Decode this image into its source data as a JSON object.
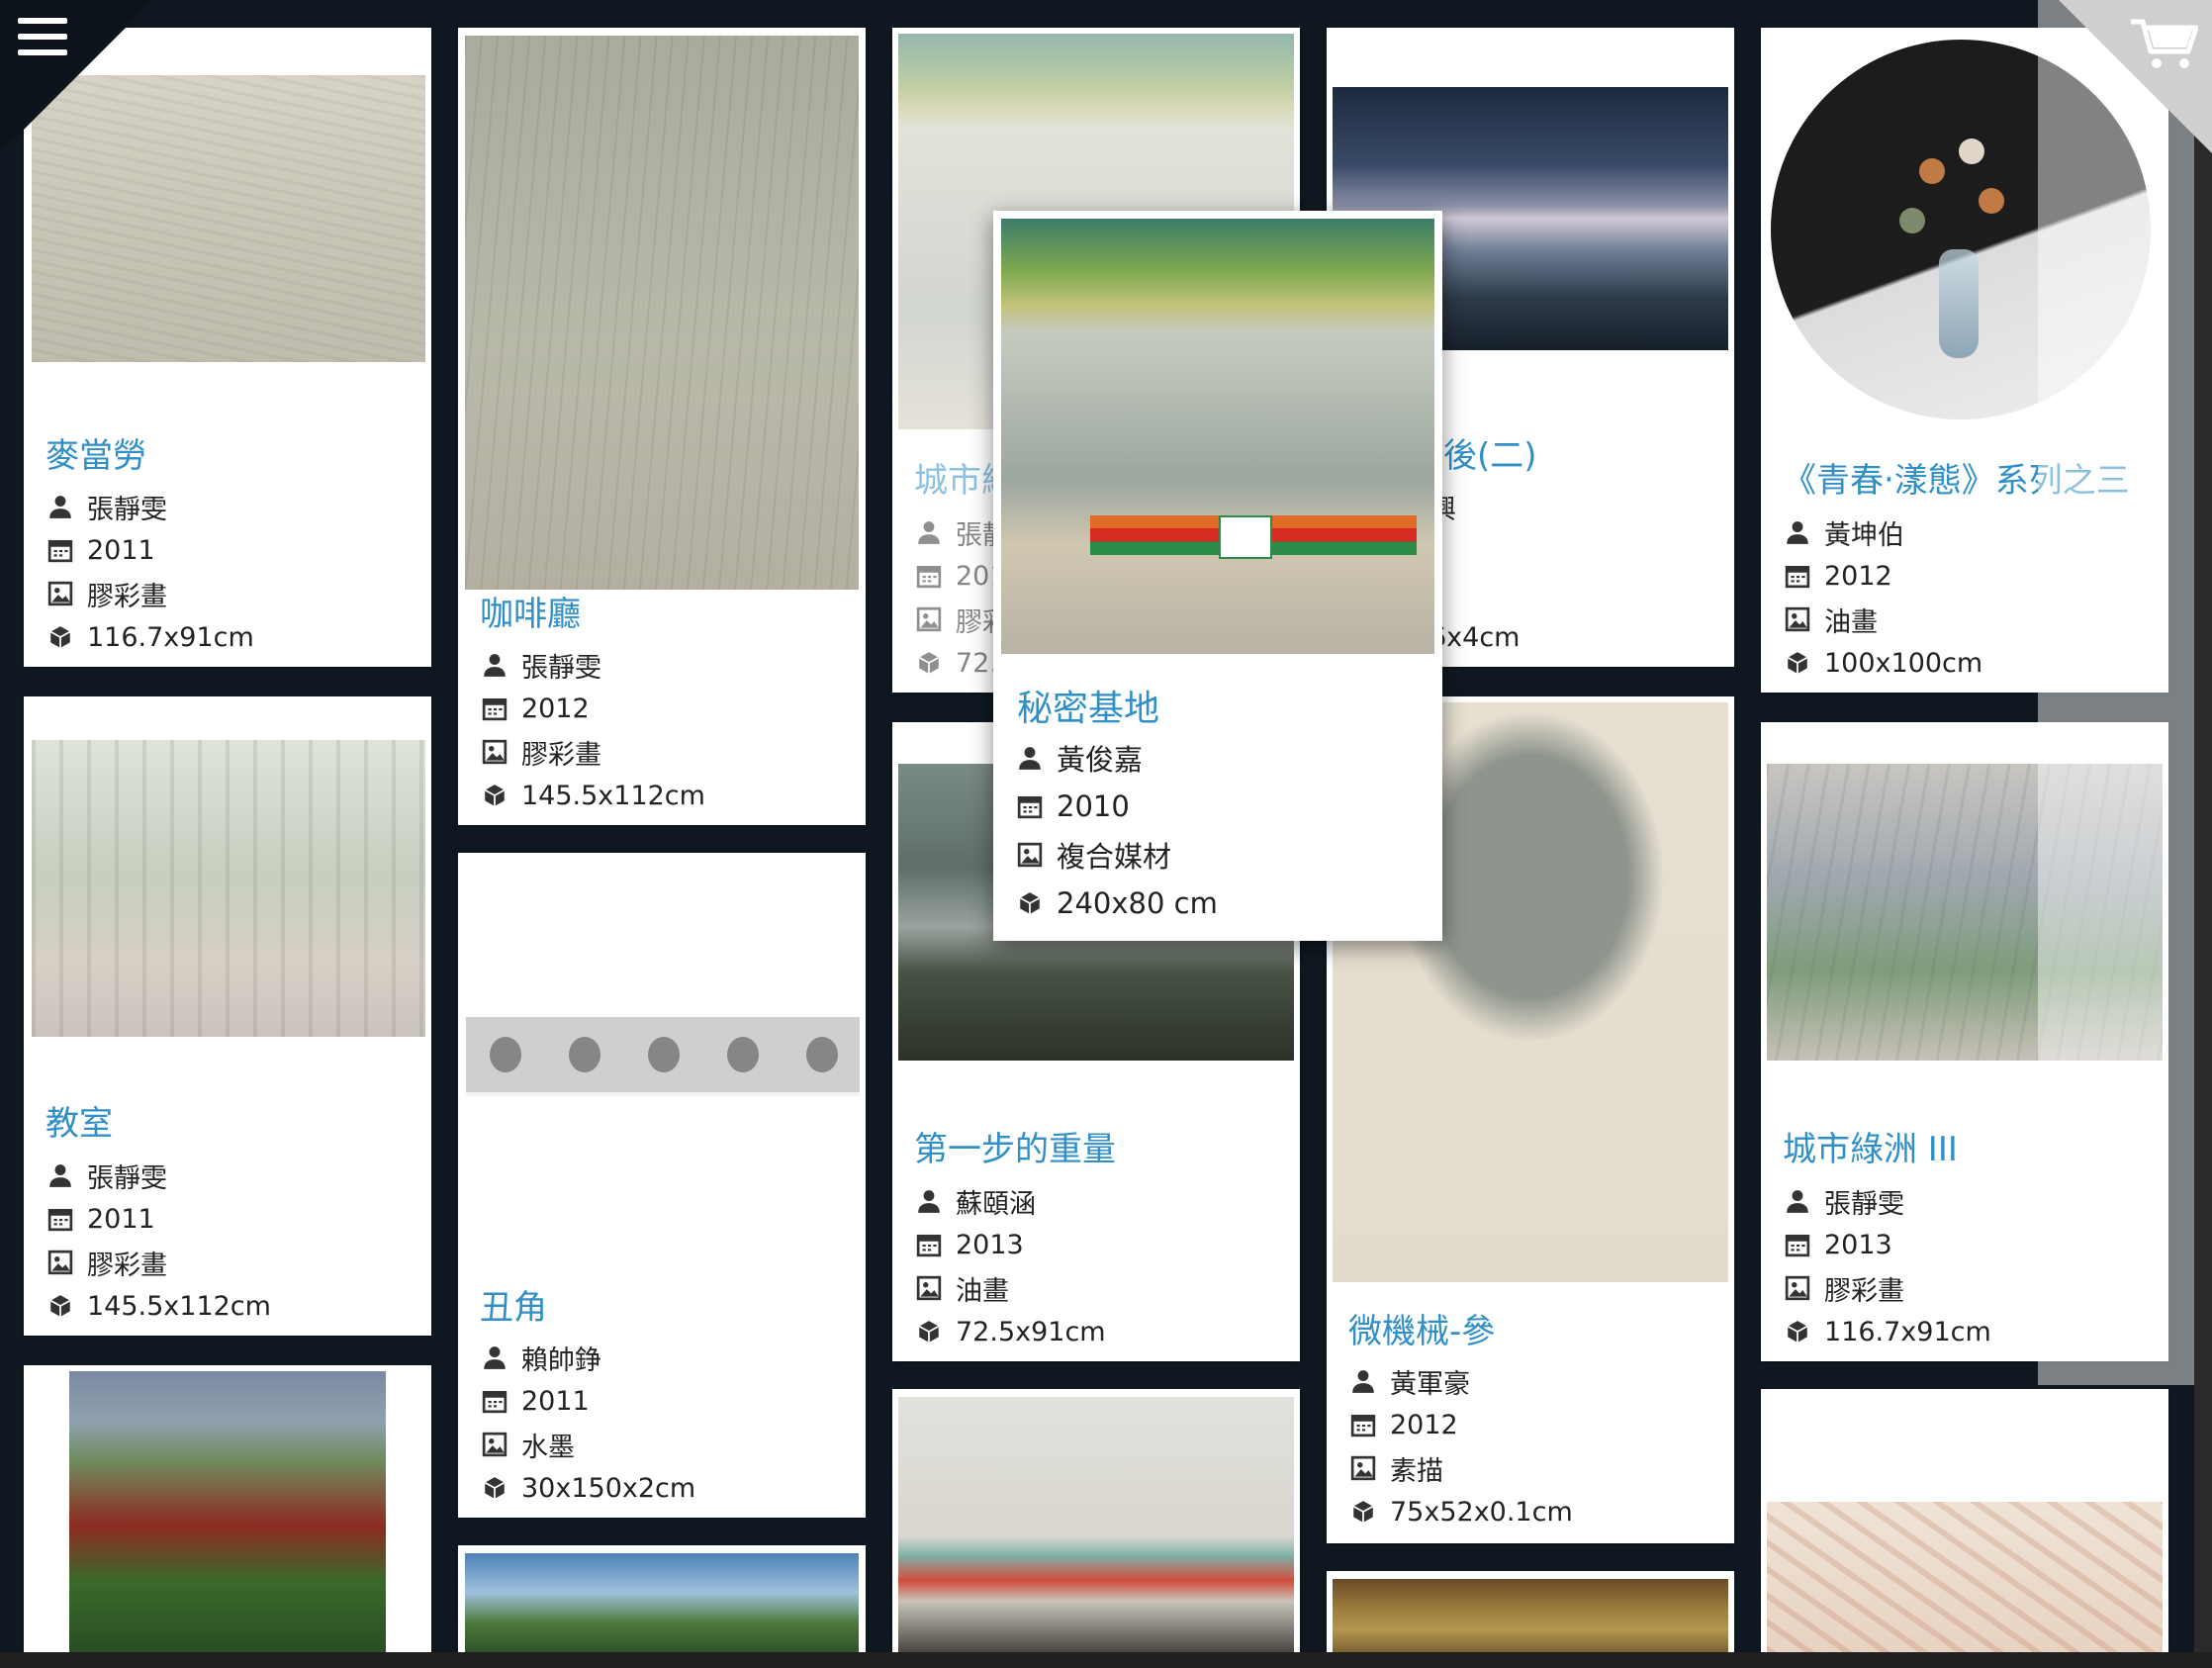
{
  "colors": {
    "background": "#0f1821",
    "card": "#ffffff",
    "title": "#2f8fc6",
    "meta_text": "#222222"
  },
  "icons": {
    "artist": "person-icon",
    "year": "calendar-icon",
    "medium": "image-icon",
    "size": "cube-icon",
    "menu": "hamburger-menu-icon",
    "cart": "shopping-cart-icon"
  },
  "artworks": [
    {
      "title": "麥當勞",
      "artist": "張靜雯",
      "year": "2011",
      "medium": "膠彩畫",
      "size": "116.7x91cm"
    },
    {
      "title": "教室",
      "artist": "張靜雯",
      "year": "2011",
      "medium": "膠彩畫",
      "size": "145.5x112cm"
    },
    {
      "title": "咖啡廳",
      "artist": "張靜雯",
      "year": "2012",
      "medium": "膠彩畫",
      "size": "145.5x112cm"
    },
    {
      "title": "丑角",
      "artist": "賴帥錚",
      "year": "2011",
      "medium": "水墨",
      "size": "30x150x2cm"
    },
    {
      "title": "城市綠洲",
      "artist": "張靜",
      "year": "201",
      "medium": "膠彩",
      "size": "72.5"
    },
    {
      "title": "第一步的重量",
      "artist": "蘇頤涵",
      "year": "2013",
      "medium": "油畫",
      "size": "72.5x91cm"
    },
    {
      "title": "後(二)",
      "artist": "興",
      "year": "",
      "medium": "",
      "size": "6x4cm"
    },
    {
      "title": "微機械-參",
      "artist": "黃軍豪",
      "year": "2012",
      "medium": "素描",
      "size": "75x52x0.1cm"
    },
    {
      "title": "《青春‧漾態》系列之三",
      "artist": "黃坤伯",
      "year": "2012",
      "medium": "油畫",
      "size": "100x100cm"
    },
    {
      "title": "城市綠洲 III",
      "artist": "張靜雯",
      "year": "2013",
      "medium": "膠彩畫",
      "size": "116.7x91cm"
    }
  ],
  "popup": {
    "title": "秘密基地",
    "artist": "黃俊嘉",
    "year": "2010",
    "medium": "複合媒材",
    "size": "240x80 cm"
  }
}
